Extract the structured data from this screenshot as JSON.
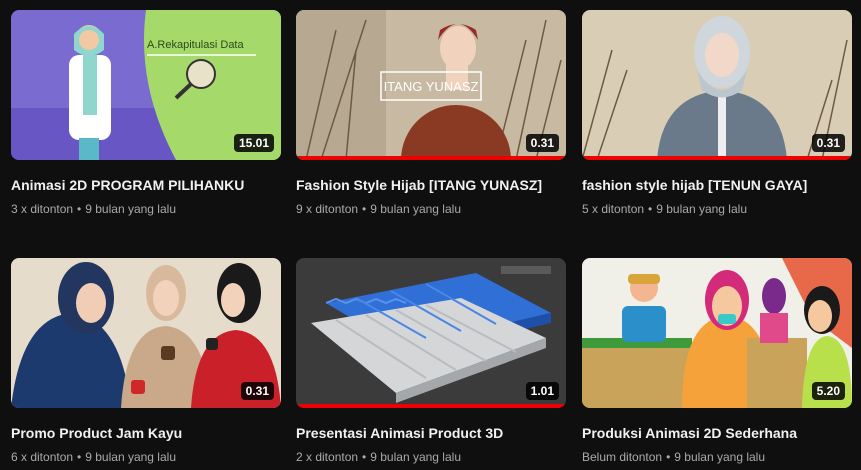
{
  "videos": [
    {
      "title": "Animasi 2D PROGRAM PILIHANKU",
      "views": "3 x ditonton",
      "age": "9 bulan yang lalu",
      "duration": "15.01",
      "thumb_text": "A.Rekapitulasi Data"
    },
    {
      "title": "Fashion Style Hijab [ITANG YUNASZ]",
      "views": "9 x ditonton",
      "age": "9 bulan yang lalu",
      "duration": "0.31",
      "thumb_text": "ITANG YUNASZ"
    },
    {
      "title": "fashion style hijab [TENUN GAYA]",
      "views": "5 x ditonton",
      "age": "9 bulan yang lalu",
      "duration": "0.31"
    },
    {
      "title": "Promo Product Jam Kayu",
      "views": "6 x ditonton",
      "age": "9 bulan yang lalu",
      "duration": "0.31"
    },
    {
      "title": "Presentasi Animasi Product 3D",
      "views": "2 x ditonton",
      "age": "9 bulan yang lalu",
      "duration": "1.01"
    },
    {
      "title": "Produksi Animasi 2D Sederhana",
      "views": "Belum ditonton",
      "age": "9 bulan yang lalu",
      "duration": "5.20"
    }
  ],
  "separator": "•",
  "colors": {
    "background": "#0f0f0f",
    "progress": "#e00000",
    "meta_text": "#aaaaaa"
  }
}
